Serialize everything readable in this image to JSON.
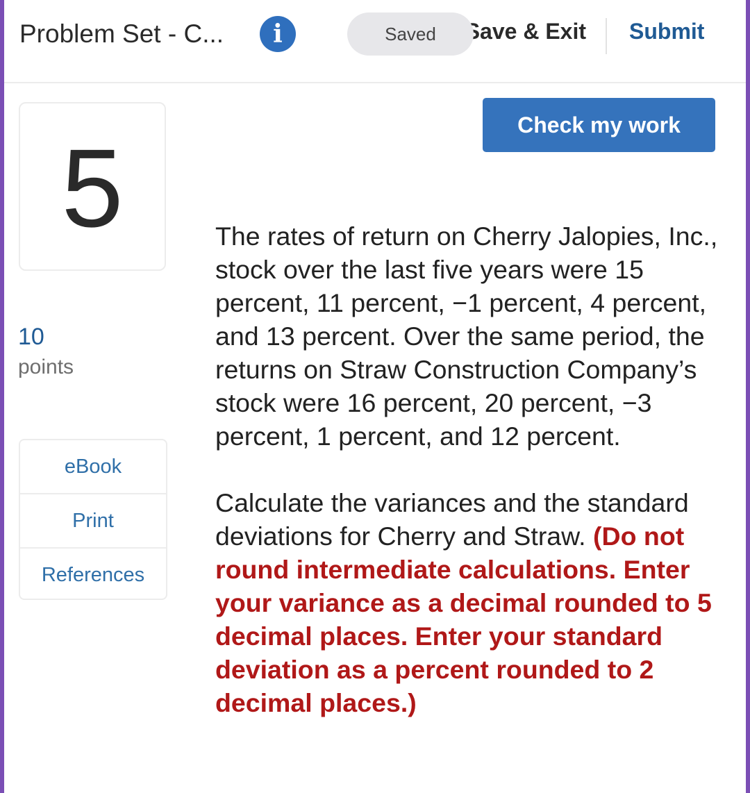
{
  "header": {
    "title": "Problem Set - C...",
    "info_icon": "info-icon",
    "save_exit_label": "Save & Exit",
    "saved_badge": "Saved",
    "submit_label": "Submit"
  },
  "question": {
    "number": "5",
    "points_value": "10",
    "points_label": "points"
  },
  "resources": [
    {
      "label": "eBook"
    },
    {
      "label": "Print"
    },
    {
      "label": "References"
    }
  ],
  "check_work_label": "Check my work",
  "problem": {
    "paragraph1": "The rates of return on Cherry Jalopies, Inc., stock over the last five years were 15 percent, 11 percent, −1 percent, 4 percent, and 13 percent. Over the same period, the returns on Straw Construction Company’s stock were 16 percent, 20 percent, −3 percent, 1 percent, and 12 percent.",
    "paragraph2_plain": "Calculate the variances and the standard deviations for Cherry and Straw. ",
    "paragraph2_emphasis": "(Do not round intermediate calculations. Enter your variance as a decimal rounded to 5 decimal places. Enter your standard deviation as a percent rounded to 2 decimal places.)"
  },
  "colors": {
    "accent_blue": "#3573bc",
    "link_blue": "#2f6fa8",
    "emphasis_red": "#b01818",
    "frame_purple": "#7b4fb5"
  }
}
